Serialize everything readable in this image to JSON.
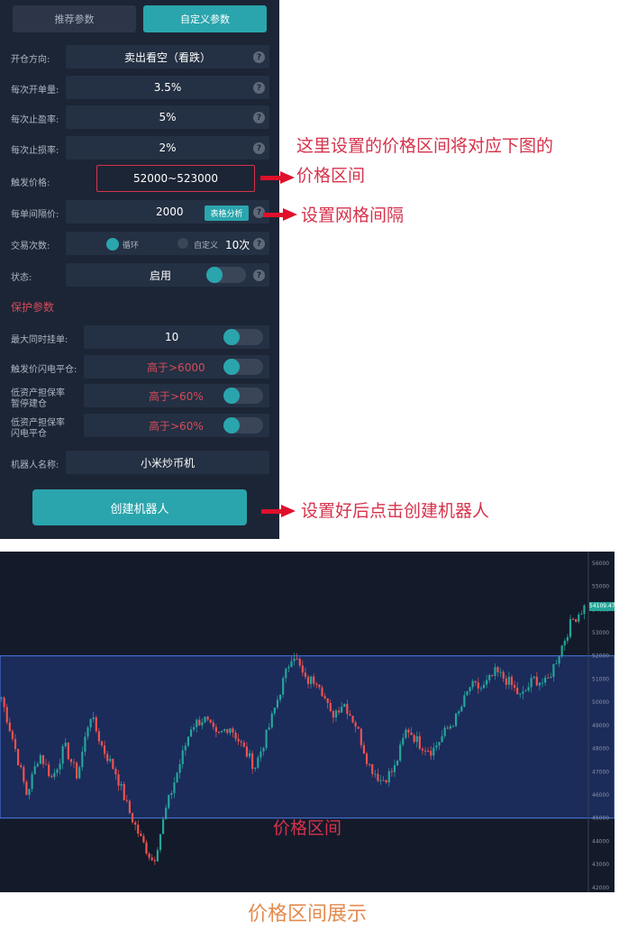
{
  "tabs": {
    "recommended": "推荐参数",
    "custom": "自定义参数"
  },
  "form": {
    "direction": {
      "label": "开仓方向:",
      "value": "卖出看空（看跌）"
    },
    "per_order": {
      "label": "每次开单量:",
      "value": "3.5%"
    },
    "take_profit": {
      "label": "每次止盈率:",
      "value": "5%"
    },
    "stop_loss": {
      "label": "每次止损率:",
      "value": "2%"
    },
    "trigger_price": {
      "label": "触发价格:",
      "value": "52000~523000"
    },
    "interval": {
      "label": "每单间隔价:",
      "value": "2000",
      "button": "表格分析"
    },
    "trade_count": {
      "label": "交易次数:",
      "loop": "循环",
      "custom": "自定义",
      "count": "10次"
    },
    "status": {
      "label": "状态:",
      "value": "启用"
    }
  },
  "protect": {
    "title": "保护参数",
    "max_orders": {
      "label": "最大同时挂单:",
      "value": "10"
    },
    "trigger_flash": {
      "label": "触发价闪电平仓:",
      "value": "高于>6000"
    },
    "low_pause": {
      "label1": "低资产担保率",
      "label2": "暂停建仓",
      "value": "高于>60%"
    },
    "low_flash": {
      "label1": "低资产担保率",
      "label2": "闪电平仓",
      "value": "高于>60%"
    }
  },
  "robot": {
    "label": "机器人名称:",
    "value": "小米炒币机"
  },
  "create_button": "创建机器人",
  "help_glyph": "?",
  "notes": {
    "price_range_1": "这里设置的价格区间将对应下图的",
    "price_range_2": "价格区间",
    "grid": "设置网格间隔",
    "create": "设置好后点击创建机器人"
  },
  "chart_data": {
    "type": "candlestick",
    "band_label": "价格区间",
    "band_low": 45000,
    "band_high": 52000,
    "ylim": [
      41800,
      56500
    ],
    "y_ticks": [
      56000,
      55000,
      54000,
      53000,
      52000,
      51000,
      50000,
      49000,
      48000,
      47000,
      46000,
      45000,
      44000,
      43000,
      42000
    ],
    "last_price": "54109.47",
    "close_path": [
      50200,
      48200,
      46000,
      47800,
      46700,
      48100,
      46800,
      49500,
      48000,
      47000,
      45400,
      44100,
      43100,
      45400,
      47200,
      49000,
      49300,
      48500,
      49000,
      48100,
      47200,
      48700,
      50500,
      52200,
      50900,
      51000,
      49400,
      50000,
      49000,
      47300,
      46600,
      47100,
      48900,
      48200,
      47900,
      48700,
      49400,
      50700,
      50600,
      51300,
      50900,
      50200,
      51000,
      50800,
      52100,
      53500,
      54100
    ]
  },
  "caption": "价格区间展示"
}
